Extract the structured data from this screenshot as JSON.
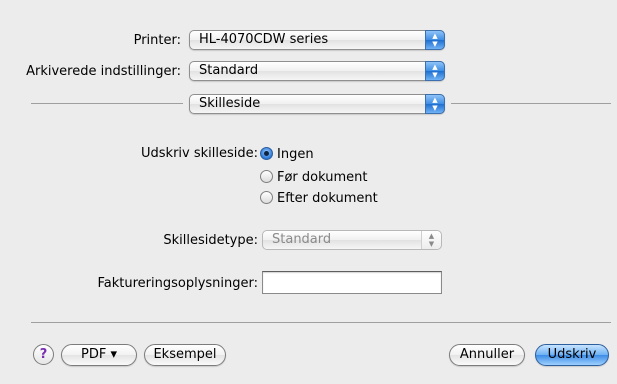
{
  "printer": {
    "label": "Printer:",
    "value": "HL-4070CDW series"
  },
  "presets": {
    "label": "Arkiverede indstillinger:",
    "value": "Standard"
  },
  "panel": {
    "value": "Skilleside"
  },
  "cover_page": {
    "label": "Udskriv skilleside:",
    "options": [
      {
        "label": "Ingen",
        "selected": true
      },
      {
        "label": "Før dokument",
        "selected": false
      },
      {
        "label": "Efter dokument",
        "selected": false
      }
    ]
  },
  "cover_type": {
    "label": "Skillesidetype:",
    "value": "Standard",
    "enabled": false
  },
  "billing": {
    "label": "Faktureringsoplysninger:",
    "value": ""
  },
  "footer": {
    "help": "?",
    "pdf": "PDF ▾",
    "preview": "Eksempel",
    "cancel": "Annuller",
    "print": "Udskriv"
  },
  "icons": {
    "popup": "up-down-stepper-icon",
    "help": "question-mark-icon"
  },
  "colors": {
    "accent": "#3c8ce6",
    "background": "#ececec"
  }
}
